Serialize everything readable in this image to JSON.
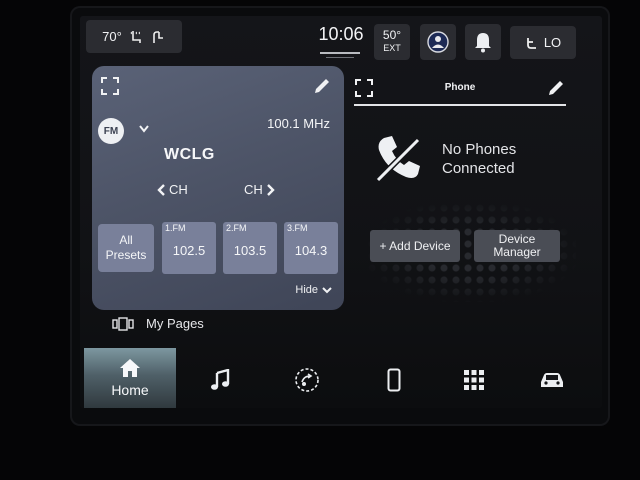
{
  "status_bar": {
    "interior_temp": "70°",
    "time": "10:06",
    "exterior_temp": "50°",
    "exterior_label": "EXT",
    "fan_level": "LO"
  },
  "radio": {
    "band": "FM",
    "frequency": "100.1 MHz",
    "station": "WCLG",
    "ch_prev_label": "CH",
    "ch_next_label": "CH",
    "all_presets_line1": "All",
    "all_presets_line2": "Presets",
    "presets": [
      {
        "label": "1.FM",
        "value": "102.5"
      },
      {
        "label": "2.FM",
        "value": "103.5"
      },
      {
        "label": "3.FM",
        "value": "104.3"
      }
    ],
    "hide_label": "Hide"
  },
  "my_pages": {
    "label": "My Pages"
  },
  "phone": {
    "title": "Phone",
    "status_line1": "No Phones",
    "status_line2": "Connected",
    "add_device_label": "+ Add Device",
    "device_manager_line1": "Device",
    "device_manager_line2": "Manager"
  },
  "bottom_nav": {
    "home_label": "Home",
    "icons": [
      "home-icon",
      "music-icon",
      "controls-icon",
      "phone-device-icon",
      "apps-grid-icon",
      "vehicle-icon"
    ]
  },
  "colors": {
    "radio_card": "#4d5467",
    "preset_button": "#79809a",
    "home_tab": "#5d737b",
    "pill_background": "#2b2c31"
  }
}
